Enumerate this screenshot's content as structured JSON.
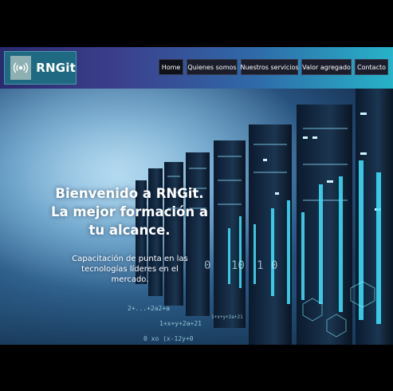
{
  "brand": {
    "name": "RNGit",
    "logo_icon": "broadcast-icon"
  },
  "nav": {
    "items": [
      {
        "label": "Home",
        "active": true
      },
      {
        "label": "Quienes somos",
        "active": false
      },
      {
        "label": "Nuestros servicios",
        "active": false
      },
      {
        "label": "Valor agregado",
        "active": false
      },
      {
        "label": "Contacto",
        "active": false
      }
    ]
  },
  "hero": {
    "headline_line1": "Bienvenido a RNGit.",
    "headline_line2": "La mejor formación a tu alcance.",
    "subtext": "Capacitación de punta en las tecnologías líderes en el mercado.",
    "background": "server-room-data-image"
  },
  "colors": {
    "navbar_start": "#2a2a6e",
    "navbar_end": "#27b3c8",
    "brand_box": "#1f6a82",
    "nav_button": "#1b1d2b",
    "accent_cyan": "#3ee6ff"
  }
}
